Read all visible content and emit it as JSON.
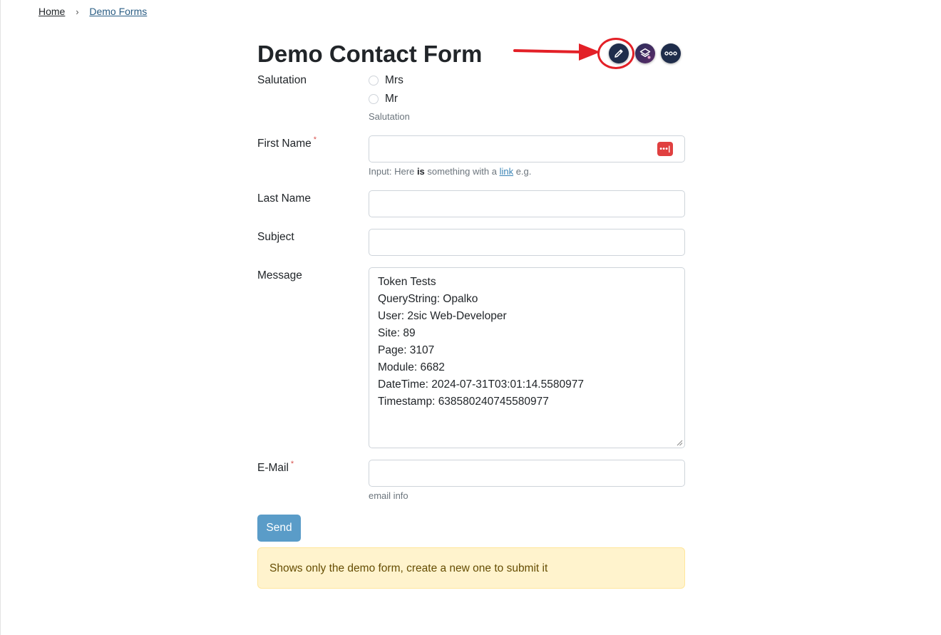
{
  "breadcrumb": {
    "home": "Home",
    "separator": "›",
    "current": "Demo Forms"
  },
  "page": {
    "title": "Demo Contact Form"
  },
  "toolbar": {
    "edit_icon": "pencil-icon",
    "layers_icon": "layers-icon",
    "more_icon": "more-icon",
    "dark_color": "#1f2d4b"
  },
  "annotation": {
    "color": "#e32027"
  },
  "form": {
    "salutation": {
      "label": "Salutation",
      "options": [
        "Mrs",
        "Mr"
      ],
      "hint": "Salutation"
    },
    "first_name": {
      "label": "First Name",
      "required_mark": "*",
      "value": "",
      "hint_before": "Input: Here ",
      "hint_bold": "is",
      "hint_middle": " something with a ",
      "hint_link": "link",
      "hint_after": " e.g."
    },
    "last_name": {
      "label": "Last Name",
      "value": ""
    },
    "subject": {
      "label": "Subject",
      "value": ""
    },
    "message": {
      "label": "Message",
      "lines": [
        "Token Tests",
        "QueryString: Opalko",
        "User: 2sic Web-Developer",
        "Site: 89",
        "Page: 3107",
        "Module: 6682",
        "DateTime: 2024-07-31T03:01:14.5580977",
        "Timestamp: 638580240745580977"
      ]
    },
    "email": {
      "label": "E-Mail",
      "required_mark": "*",
      "value": "",
      "hint": "email info"
    },
    "send_label": "Send",
    "send_color": "#5a9cc8"
  },
  "alert": {
    "text": "Shows only the demo form, create a new one to submit it"
  }
}
